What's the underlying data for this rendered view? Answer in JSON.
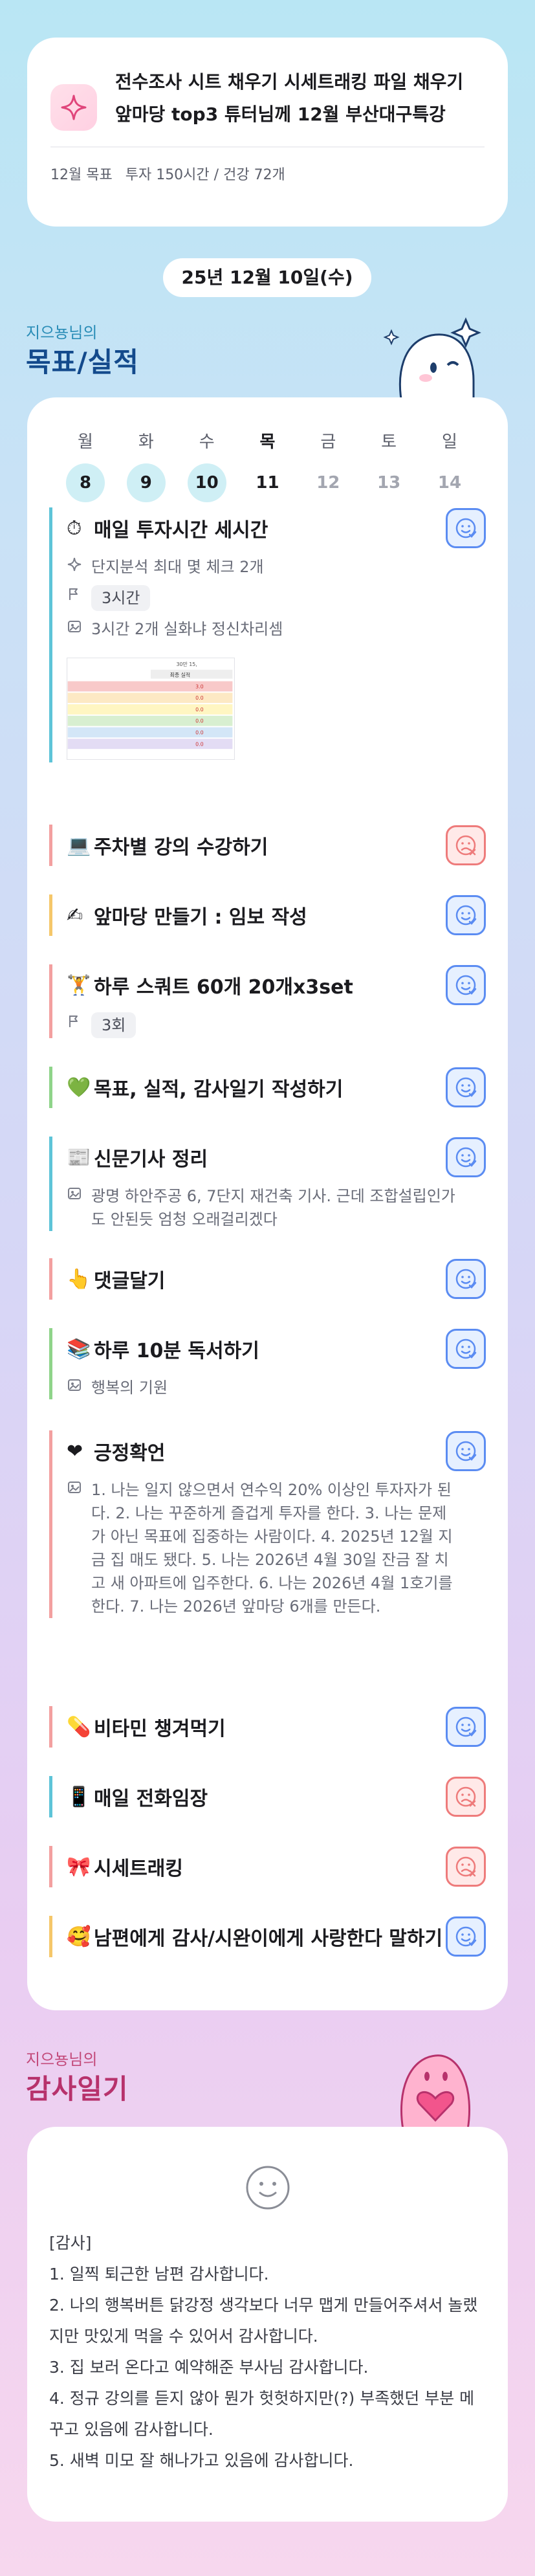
{
  "header": {
    "title": "전수조사 시트 채우기 시세트래킹 파일 채우기 앞마당 top3 튜터님께 12월 부산대구특강",
    "goal_label": "12월 목표",
    "invest": "투자 150시간",
    "separator": "/",
    "health": "건강 72개"
  },
  "date": "25년 12월 10일(수)",
  "goals_section": {
    "owner": "지으뇽님의",
    "title": "목표/실적"
  },
  "week": [
    {
      "name": "월",
      "num": "8",
      "state": "done"
    },
    {
      "name": "화",
      "num": "9",
      "state": "done"
    },
    {
      "name": "수",
      "num": "10",
      "state": "done"
    },
    {
      "name": "목",
      "num": "11",
      "state": "today"
    },
    {
      "name": "금",
      "num": "12",
      "state": "future"
    },
    {
      "name": "토",
      "num": "13",
      "state": "future"
    },
    {
      "name": "일",
      "num": "14",
      "state": "future"
    }
  ],
  "goals": [
    {
      "emoji": "⏱",
      "title": "매일 투자시간 세시간",
      "status": "done",
      "color": "#5ec4d8",
      "sub": "단지분석 최대 몇 체크 2개",
      "chip": "3시간",
      "note": "3시간 2개 실화냐 정신차리셈"
    },
    {
      "emoji": "💻",
      "title": "주차별 강의 수강하기",
      "status": "missed",
      "color": "#f3a0a0"
    },
    {
      "emoji": "✍",
      "title": "앞마당 만들기 : 임보 작성",
      "status": "done",
      "color": "#f5c76a"
    },
    {
      "emoji": "🏋",
      "title": "하루 스쿼트 60개 20개x3set",
      "status": "done",
      "color": "#f3a0a0",
      "chip": "3회"
    },
    {
      "emoji": "💚",
      "title": "목표, 실적, 감사일기 작성하기",
      "status": "done",
      "color": "#8fd48a"
    },
    {
      "emoji": "📰",
      "title": "신문기사 정리",
      "status": "done",
      "color": "#5ec4d8",
      "note": "광명 하안주공 6, 7단지 재건축 기사. 근데 조합설립인가도 안된듯 엄청 오래걸리겠다"
    },
    {
      "emoji": "👆",
      "title": "댓글달기",
      "status": "done",
      "color": "#f3a0a0"
    },
    {
      "emoji": "📚",
      "title": "하루 10분 독서하기",
      "status": "done",
      "color": "#8fd48a",
      "note": "행복의 기원"
    },
    {
      "emoji": "❤",
      "title": "긍정확언",
      "status": "done",
      "color": "#f3a0a0",
      "note": "1. 나는 일지 않으면서 연수익 20% 이상인 투자자가 된다. 2. 나는 꾸준하게 즐겁게 투자를 한다. 3. 나는 문제가 아닌 목표에 집중하는 사람이다. 4. 2025년 12월 지금 집 매도 됐다. 5. 나는 2026년 4월 30일 잔금 잘 치고 새 아파트에 입주한다. 6. 나는 2026년 4월 1호기를 한다. 7. 나는 2026년 앞마당 6개를 만든다."
    },
    {
      "emoji": "💊",
      "title": "비타민 챙겨먹기",
      "status": "done",
      "color": "#f3a0a0"
    },
    {
      "emoji": "📱",
      "title": "매일 전화임장",
      "status": "missed",
      "color": "#5ec4d8"
    },
    {
      "emoji": "🎀",
      "title": "시세트래킹",
      "status": "missed",
      "color": "#f3a0a0"
    },
    {
      "emoji": "🥰",
      "title": "남편에게 감사/시완이에게 사랑한다 말하기",
      "status": "done",
      "color": "#f5c76a"
    }
  ],
  "thumbnail": {
    "header": "30만 15,",
    "col_label": "최종 실적",
    "rows": [
      "3.0",
      "0.0",
      "0.0",
      "0.0",
      "0.0",
      "0.0"
    ]
  },
  "diary_section": {
    "owner": "지으뇽님의",
    "title": "감사일기"
  },
  "diary": "[감사]\n1. 일찍 퇴근한 남편 감사합니다.\n2. 나의 행복버튼 닭강정 생각보다 너무 맵게 만들어주셔서 놀랬지만 맛있게 먹을 수 있어서 감사합니다.\n3. 집 보러 온다고 예약해준 부사님 감사합니다.\n4. 정규 강의를 듣지 않아 뭔가 헛헛하지만(?) 부족했던 부분 메꾸고 있음에 감사합니다.\n5. 새벽 미모 잘 해나가고 있음에 감사합니다.",
  "colors": {
    "accent_blue": "#5b8cf2",
    "missed_red": "#ee7b7b",
    "title_navy": "#134a8c",
    "title_pink": "#b7326c"
  },
  "icons": {
    "header": "sparkle-icon",
    "sub": "sparkle-icon",
    "chip": "flag-icon",
    "note": "image-note-icon",
    "done": "smile-check-icon",
    "missed": "sad-x-icon"
  }
}
